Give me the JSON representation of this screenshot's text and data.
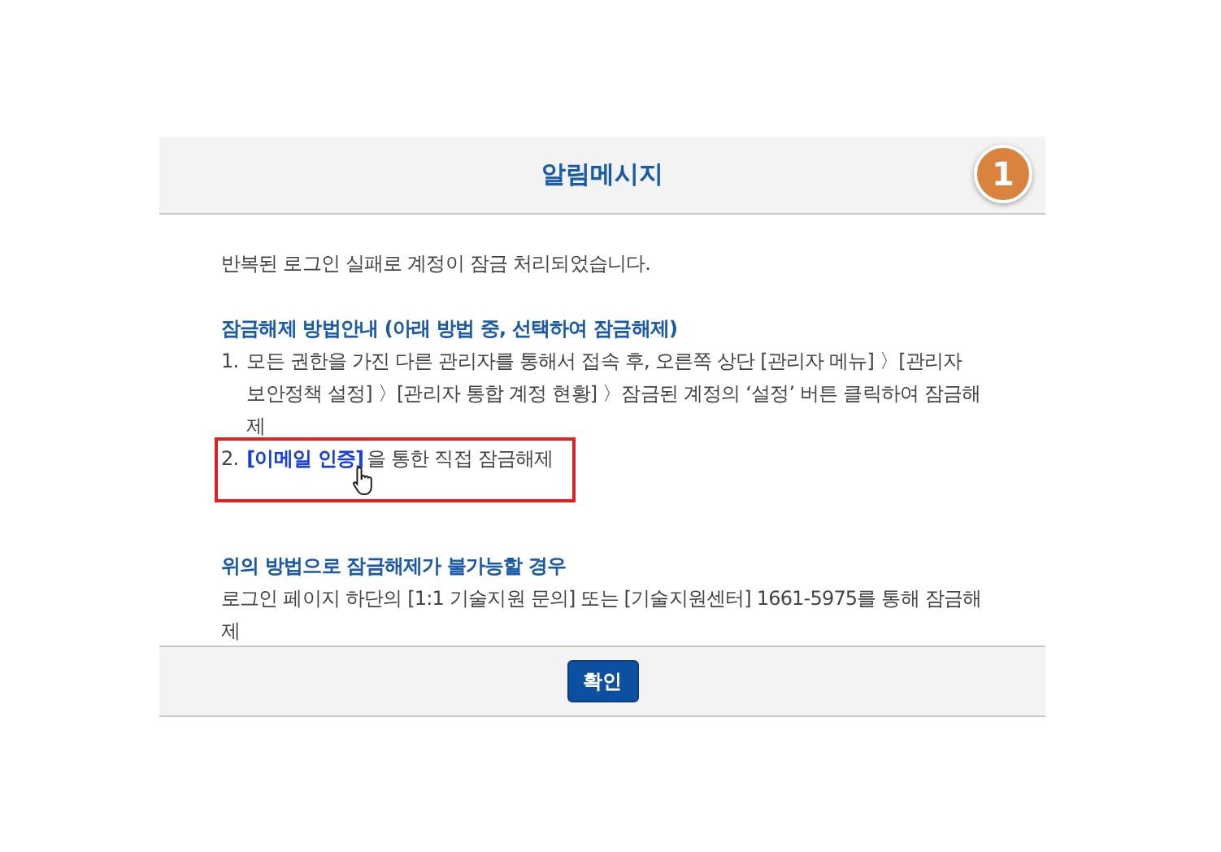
{
  "dialog": {
    "title": "알림메시지",
    "step_badge": "1",
    "message": "반복된 로그인 실패로 계정이 잠금 처리되었습니다.",
    "guide": {
      "heading": "잠금해제 방법안내 (아래 방법 중, 선택하여 잠금해제)",
      "steps": [
        {
          "number": "1.",
          "text": "모든 권한을 가진 다른 관리자를 통해서 접속 후, 오른쪽 상단 [관리자 메뉴] 〉[관리자 보안정책 설정] 〉[관리자 통합 계정 현황] 〉잠금된 계정의 ‘설정’ 버튼 클릭하여 잠금해제"
        },
        {
          "number": "2.",
          "link": "[이메일 인증]",
          "text": "을 통한 직접 잠금해제",
          "highlighted": true
        }
      ]
    },
    "fallback": {
      "heading": "위의 방법으로 잠금해제가 불가능할 경우",
      "text": "로그인 페이지 하단의 [1:1 기술지원 문의] 또는 [기술지원센터] 1661-5975를 통해 잠금해제"
    },
    "confirm_button": "확인"
  }
}
